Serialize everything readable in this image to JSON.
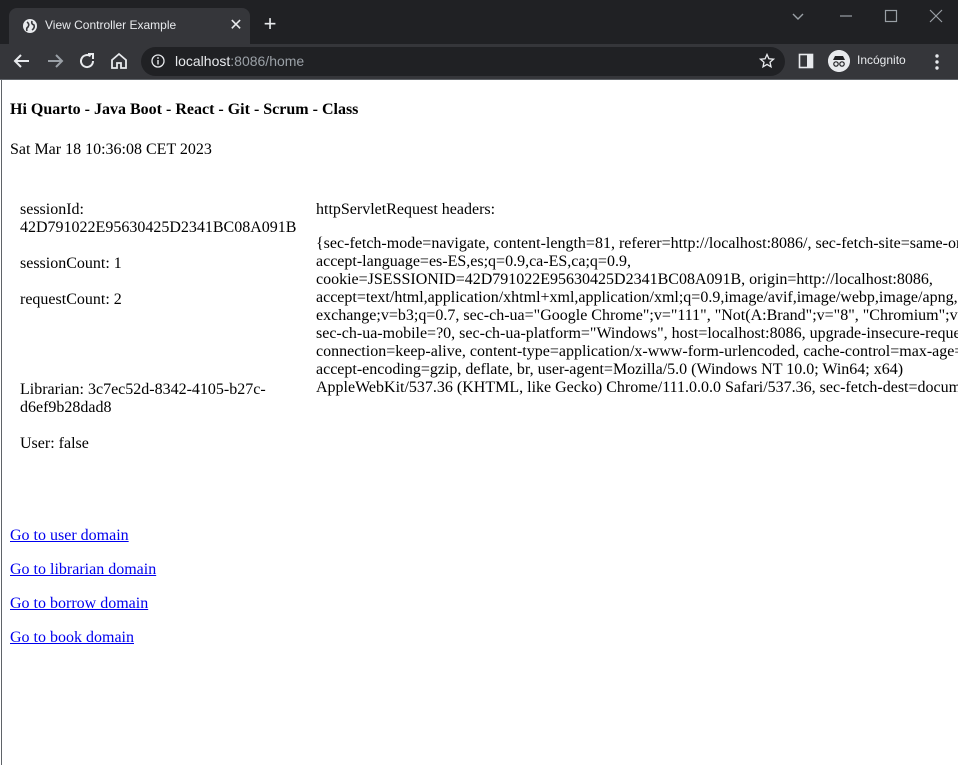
{
  "browser": {
    "tab_title": "View Controller Example",
    "url_host": "localhost",
    "url_rest": ":8086/home",
    "incognito_label": "Incógnito"
  },
  "page": {
    "greeting": "Hi Quarto - Java Boot - React - Git - Scrum - Class",
    "date": "Sat Mar 18 10:36:08 CET 2023",
    "session_id_label": "sessionId:",
    "session_id": "42D791022E95630425D2341BC08A091B",
    "session_count": "sessionCount: 1",
    "request_count": "requestCount: 2",
    "librarian": "Librarian: 3c7ec52d-8342-4105-b27c-d6ef9b28dad8",
    "user": "User: false",
    "headers_title": "httpServletRequest headers:",
    "headers_value": "{sec-fetch-mode=navigate, content-length=81, referer=http://localhost:8086/, sec-fetch-site=same-origin, accept-language=es-ES,es;q=0.9,ca-ES,ca;q=0.9, cookie=JSESSIONID=42D791022E95630425D2341BC08A091B, origin=http://localhost:8086, accept=text/html,application/xhtml+xml,application/xml;q=0.9,image/avif,image/webp,image/apng,*/*;q=0.8,application/signed-exchange;v=b3;q=0.7, sec-ch-ua=\"Google Chrome\";v=\"111\", \"Not(A:Brand\";v=\"8\", \"Chromium\";v=\"111\", sec-ch-ua-mobile=?0, sec-ch-ua-platform=\"Windows\", host=localhost:8086, upgrade-insecure-requests=1, connection=keep-alive, content-type=application/x-www-form-urlencoded, cache-control=max-age=0, accept-encoding=gzip, deflate, br, user-agent=Mozilla/5.0 (Windows NT 10.0; Win64; x64) AppleWebKit/537.36 (KHTML, like Gecko) Chrome/111.0.0.0 Safari/537.36, sec-fetch-dest=document}"
  },
  "links": [
    "Go to user domain",
    "Go to librarian domain",
    "Go to borrow domain",
    "Go to book domain"
  ]
}
